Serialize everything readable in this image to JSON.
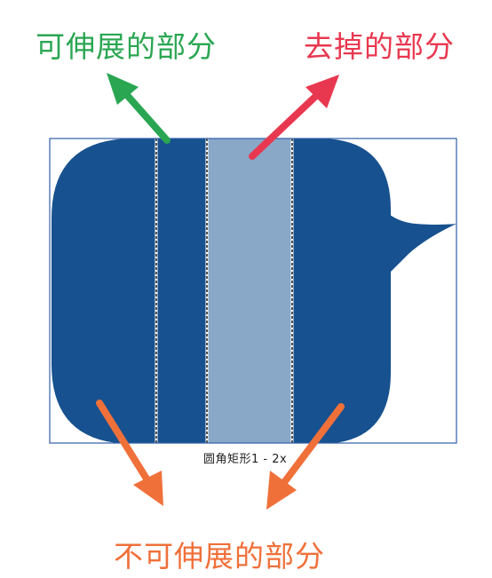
{
  "labels": {
    "stretchable": "可伸展的部分",
    "removed": "去掉的部分",
    "non_stretchable": "不可伸展的部分",
    "caption": "圆角矩形1 - 2x"
  },
  "colors": {
    "bubble": "#17518f",
    "removed_band": "#89a8c8",
    "frame": "#2f5fa8",
    "label_stretchable": "#2aa652",
    "label_removed": "#e8384f",
    "label_non_stretchable": "#f0703a"
  },
  "icons": {
    "bubble": "speech-bubble-icon",
    "arrow": "arrow-icon"
  }
}
